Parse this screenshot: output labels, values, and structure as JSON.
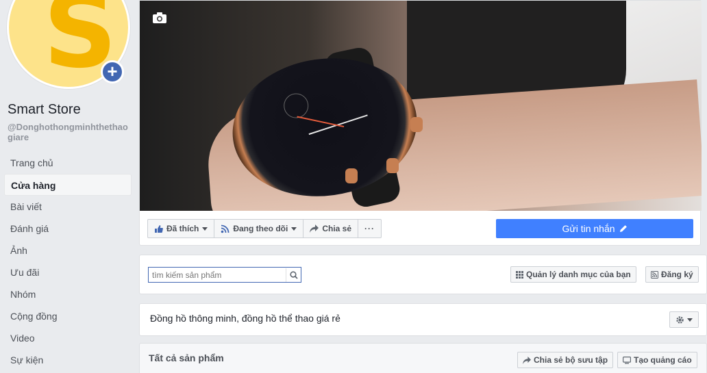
{
  "page": {
    "name": "Smart Store",
    "handle": "@Donghothongminhthethaogiare",
    "avatar_letter": "S"
  },
  "sidebar": {
    "items": [
      {
        "label": "Trang chủ"
      },
      {
        "label": "Cửa hàng",
        "active": true
      },
      {
        "label": "Bài viết"
      },
      {
        "label": "Đánh giá"
      },
      {
        "label": "Ảnh"
      },
      {
        "label": "Ưu đãi"
      },
      {
        "label": "Nhóm"
      },
      {
        "label": "Cộng đồng"
      },
      {
        "label": "Video"
      },
      {
        "label": "Sự kiện"
      }
    ]
  },
  "actions": {
    "liked_label": "Đã thích",
    "following_label": "Đang theo dõi",
    "share_label": "Chia sẻ",
    "more_label": "···",
    "send_message_label": "Gửi tin nhắn"
  },
  "shop": {
    "search_placeholder": "tìm kiếm sản phẩm",
    "manage_label": "Quản lý danh mục của bạn",
    "subscribe_label": "Đăng ký",
    "description": "Đồng hồ thông minh, đồng hồ thể thao giá rẻ",
    "all_products_title": "Tất cả sản phẩm",
    "share_collection_label": "Chia sẻ bộ sưu tập",
    "create_ad_label": "Tạo quảng cáo"
  },
  "colors": {
    "accent": "#4080ff",
    "brand": "#4267b2",
    "avatar_bg": "#fde38a",
    "avatar_letter": "#f4b400"
  }
}
